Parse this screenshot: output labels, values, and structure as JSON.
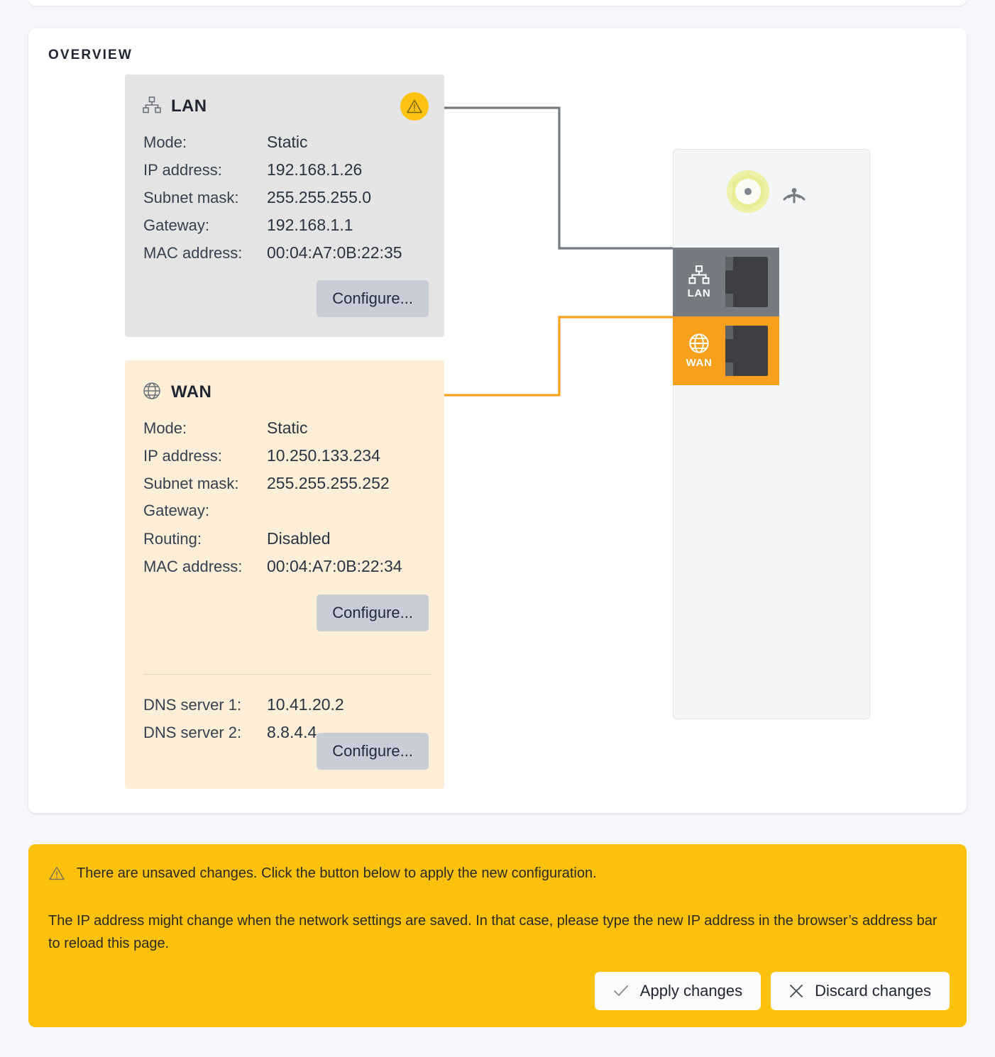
{
  "card": {
    "title": "OVERVIEW"
  },
  "lan_panel": {
    "icon": "network-tree-icon",
    "title": "LAN",
    "status_icon": "warning-triangle-icon",
    "rows": [
      {
        "label": "Mode:",
        "value": "Static"
      },
      {
        "label": "IP address:",
        "value": "192.168.1.26"
      },
      {
        "label": "Subnet mask:",
        "value": "255.255.255.0"
      },
      {
        "label": "Gateway:",
        "value": "192.168.1.1"
      },
      {
        "label": "MAC address:",
        "value": "00:04:A7:0B:22:35"
      }
    ],
    "configure_label": "Configure..."
  },
  "wan_panel": {
    "icon": "globe-icon",
    "title": "WAN",
    "rows": [
      {
        "label": "Mode:",
        "value": "Static"
      },
      {
        "label": "IP address:",
        "value": "10.250.133.234"
      },
      {
        "label": "Subnet mask:",
        "value": "255.255.255.252"
      },
      {
        "label": "Gateway:",
        "value": ""
      },
      {
        "label": "Routing:",
        "value": "Disabled"
      },
      {
        "label": "MAC address:",
        "value": "00:04:A7:0B:22:34"
      }
    ],
    "configure_label": "Configure...",
    "dns_rows": [
      {
        "label": "DNS server 1:",
        "value": "10.41.20.2"
      },
      {
        "label": "DNS server 2:",
        "value": "8.8.4.4"
      }
    ],
    "dns_configure_label": "Configure..."
  },
  "device": {
    "antenna_icon": "antenna-connector-icon",
    "wireless_icon": "wireless-signal-icon",
    "ports": [
      {
        "name": "LAN",
        "icon": "network-tree-icon",
        "color": "#767b82"
      },
      {
        "name": "WAN",
        "icon": "globe-icon",
        "color": "#f7a01b"
      }
    ]
  },
  "banner": {
    "warning_icon": "warning-triangle-icon",
    "line1": "There are unsaved changes. Click the button below to apply the new configuration.",
    "paragraph": "The IP address might change when the network settings are saved. In that case, please type the new IP address in the browser’s address bar to reload this page.",
    "apply_label": "Apply changes",
    "discard_label": "Discard changes",
    "apply_icon": "check-icon",
    "discard_icon": "close-icon"
  },
  "colors": {
    "accent_orange": "#f7a01b",
    "banner_yellow": "#fcc10d",
    "warning_yellow": "#fdc212",
    "lan_gray": "#e4e4e4",
    "wan_cream": "#fceed7",
    "wire_gray": "#767b82"
  }
}
